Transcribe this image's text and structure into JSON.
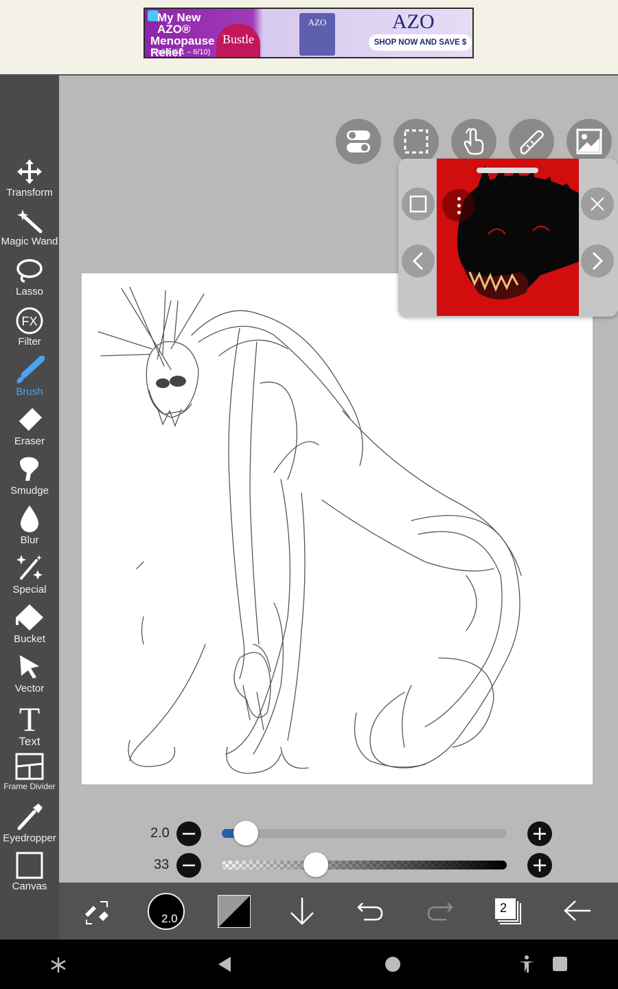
{
  "ad": {
    "headline_line1": "My New AZO®",
    "headline_line2": "Menopause",
    "headline_line3": "Relief",
    "valid": "*Valid (5/1 – 6/10)",
    "partner": "Bustle",
    "box_brand": "AZO",
    "brand": "AZO",
    "cta": "SHOP NOW AND SAVE $"
  },
  "tools": [
    {
      "label": "Transform",
      "icon": "move-arrows-icon"
    },
    {
      "label": "Magic Wand",
      "icon": "magic-wand-icon"
    },
    {
      "label": "Lasso",
      "icon": "lasso-icon"
    },
    {
      "label": "Filter",
      "icon": "fx-icon",
      "glyph": "FX"
    },
    {
      "label": "Brush",
      "icon": "brush-icon",
      "active": true
    },
    {
      "label": "Eraser",
      "icon": "eraser-icon"
    },
    {
      "label": "Smudge",
      "icon": "smudge-icon"
    },
    {
      "label": "Blur",
      "icon": "drop-icon"
    },
    {
      "label": "Special",
      "icon": "sparkle-icon"
    },
    {
      "label": "Bucket",
      "icon": "bucket-icon"
    },
    {
      "label": "Vector",
      "icon": "cursor-arrow-icon"
    },
    {
      "label": "Text",
      "icon": "text-t-icon",
      "glyph": "T"
    },
    {
      "label": "Frame Divider",
      "icon": "frame-divider-icon"
    },
    {
      "label": "Eyedropper",
      "icon": "eyedropper-icon"
    },
    {
      "label": "Canvas",
      "icon": "canvas-icon"
    }
  ],
  "colors": {
    "accent": "#4aa3ee",
    "toolbar": "#4a4a4a",
    "reference_bg": "#d10d0d"
  },
  "sliders": {
    "brush_size": {
      "value_label": "2.0",
      "value": 0.06
    },
    "opacity": {
      "value_label": "33",
      "value": 0.33
    }
  },
  "bottom": {
    "brush_size_label": "2.0",
    "layers_count": "2"
  }
}
